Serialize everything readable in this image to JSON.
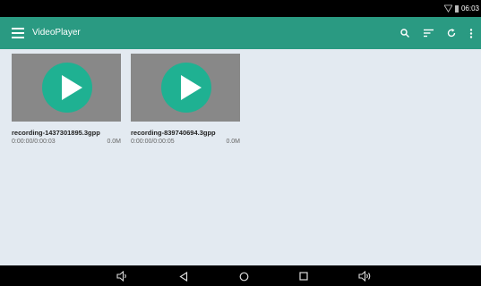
{
  "status": {
    "time": "06:03"
  },
  "app": {
    "title": "VideoPlayer"
  },
  "icons": {
    "menu": "hamburger-icon",
    "search": "search-icon",
    "sort": "sort-icon",
    "refresh": "refresh-icon",
    "more": "more-vert-icon"
  },
  "colors": {
    "accent": "#2a9a82",
    "play": "#1fb192",
    "background": "#e3eaf1"
  },
  "videos": [
    {
      "name": "recording-1437301895.3gpp",
      "duration": "0:00:00/0:00:03",
      "size": "0.0M"
    },
    {
      "name": "recording-839740694.3gpp",
      "duration": "0:00:00/0:00:05",
      "size": "0.0M"
    }
  ]
}
